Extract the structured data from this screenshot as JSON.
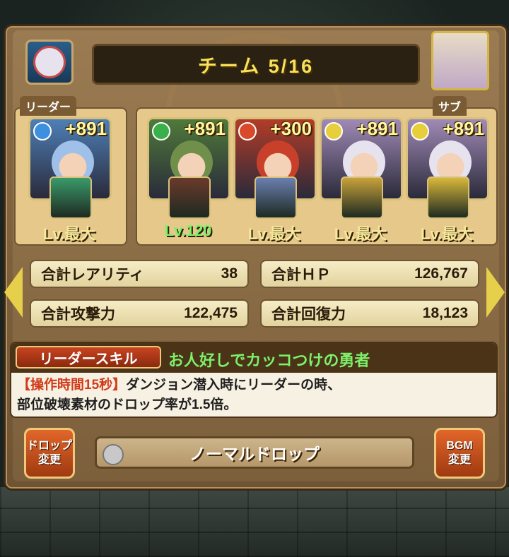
{
  "title": "チーム 5/16",
  "tags": {
    "leader": "リーダー",
    "sub": "サブ"
  },
  "team": [
    {
      "name": "leader",
      "plus": "+891",
      "level": "Lv.最大",
      "attr_color": "#3d8fe0",
      "card_color": "#4e7fb6",
      "hair": "#9fc0e8",
      "assist_color": "#3a9a6a",
      "level_color": "yellow"
    },
    {
      "name": "sub1",
      "plus": "+891",
      "level": "Lv.120",
      "attr_color": "#39b04a",
      "card_color": "#4f7a3a",
      "hair": "#6f8f4a",
      "assist_color": "#6a3a2a",
      "level_color": "green"
    },
    {
      "name": "sub2",
      "plus": "+300",
      "level": "Lv.最大",
      "attr_color": "#d84a2a",
      "card_color": "#b23c28",
      "hair": "#c8402a",
      "assist_color": "#6a7fb0",
      "level_color": "yellow"
    },
    {
      "name": "sub3",
      "plus": "+891",
      "level": "Lv.最大",
      "attr_color": "#e6cf3a",
      "card_color": "#a08ab6",
      "hair": "#e6e3ef",
      "assist_color": "#c8a23a",
      "level_color": "yellow"
    },
    {
      "name": "sub4",
      "plus": "+891",
      "level": "Lv.最大",
      "attr_color": "#e6cf3a",
      "card_color": "#a08ab6",
      "hair": "#e6e3ef",
      "assist_color": "#d8b83a",
      "level_color": "yellow"
    }
  ],
  "stats": {
    "rarity_label": "合計レアリティ",
    "rarity_value": "38",
    "hp_label": "合計ＨＰ",
    "hp_value": "126,767",
    "atk_label": "合計攻撃力",
    "atk_value": "122,475",
    "rcv_label": "合計回復力",
    "rcv_value": "18,123"
  },
  "leader_skill": {
    "badge": "リーダースキル",
    "name": "お人好しでカッコつけの勇者",
    "highlight": "【操作時間15秒】",
    "desc1": "ダンジョン潜入時にリーダーの時、",
    "desc2": "部位破壊素材のドロップ率が1.5倍。"
  },
  "buttons": {
    "drop_change_1": "ドロップ",
    "drop_change_2": "変更",
    "bgm_change_1": "BGM",
    "bgm_change_2": "変更",
    "drop_type": "ノーマルドロップ"
  }
}
